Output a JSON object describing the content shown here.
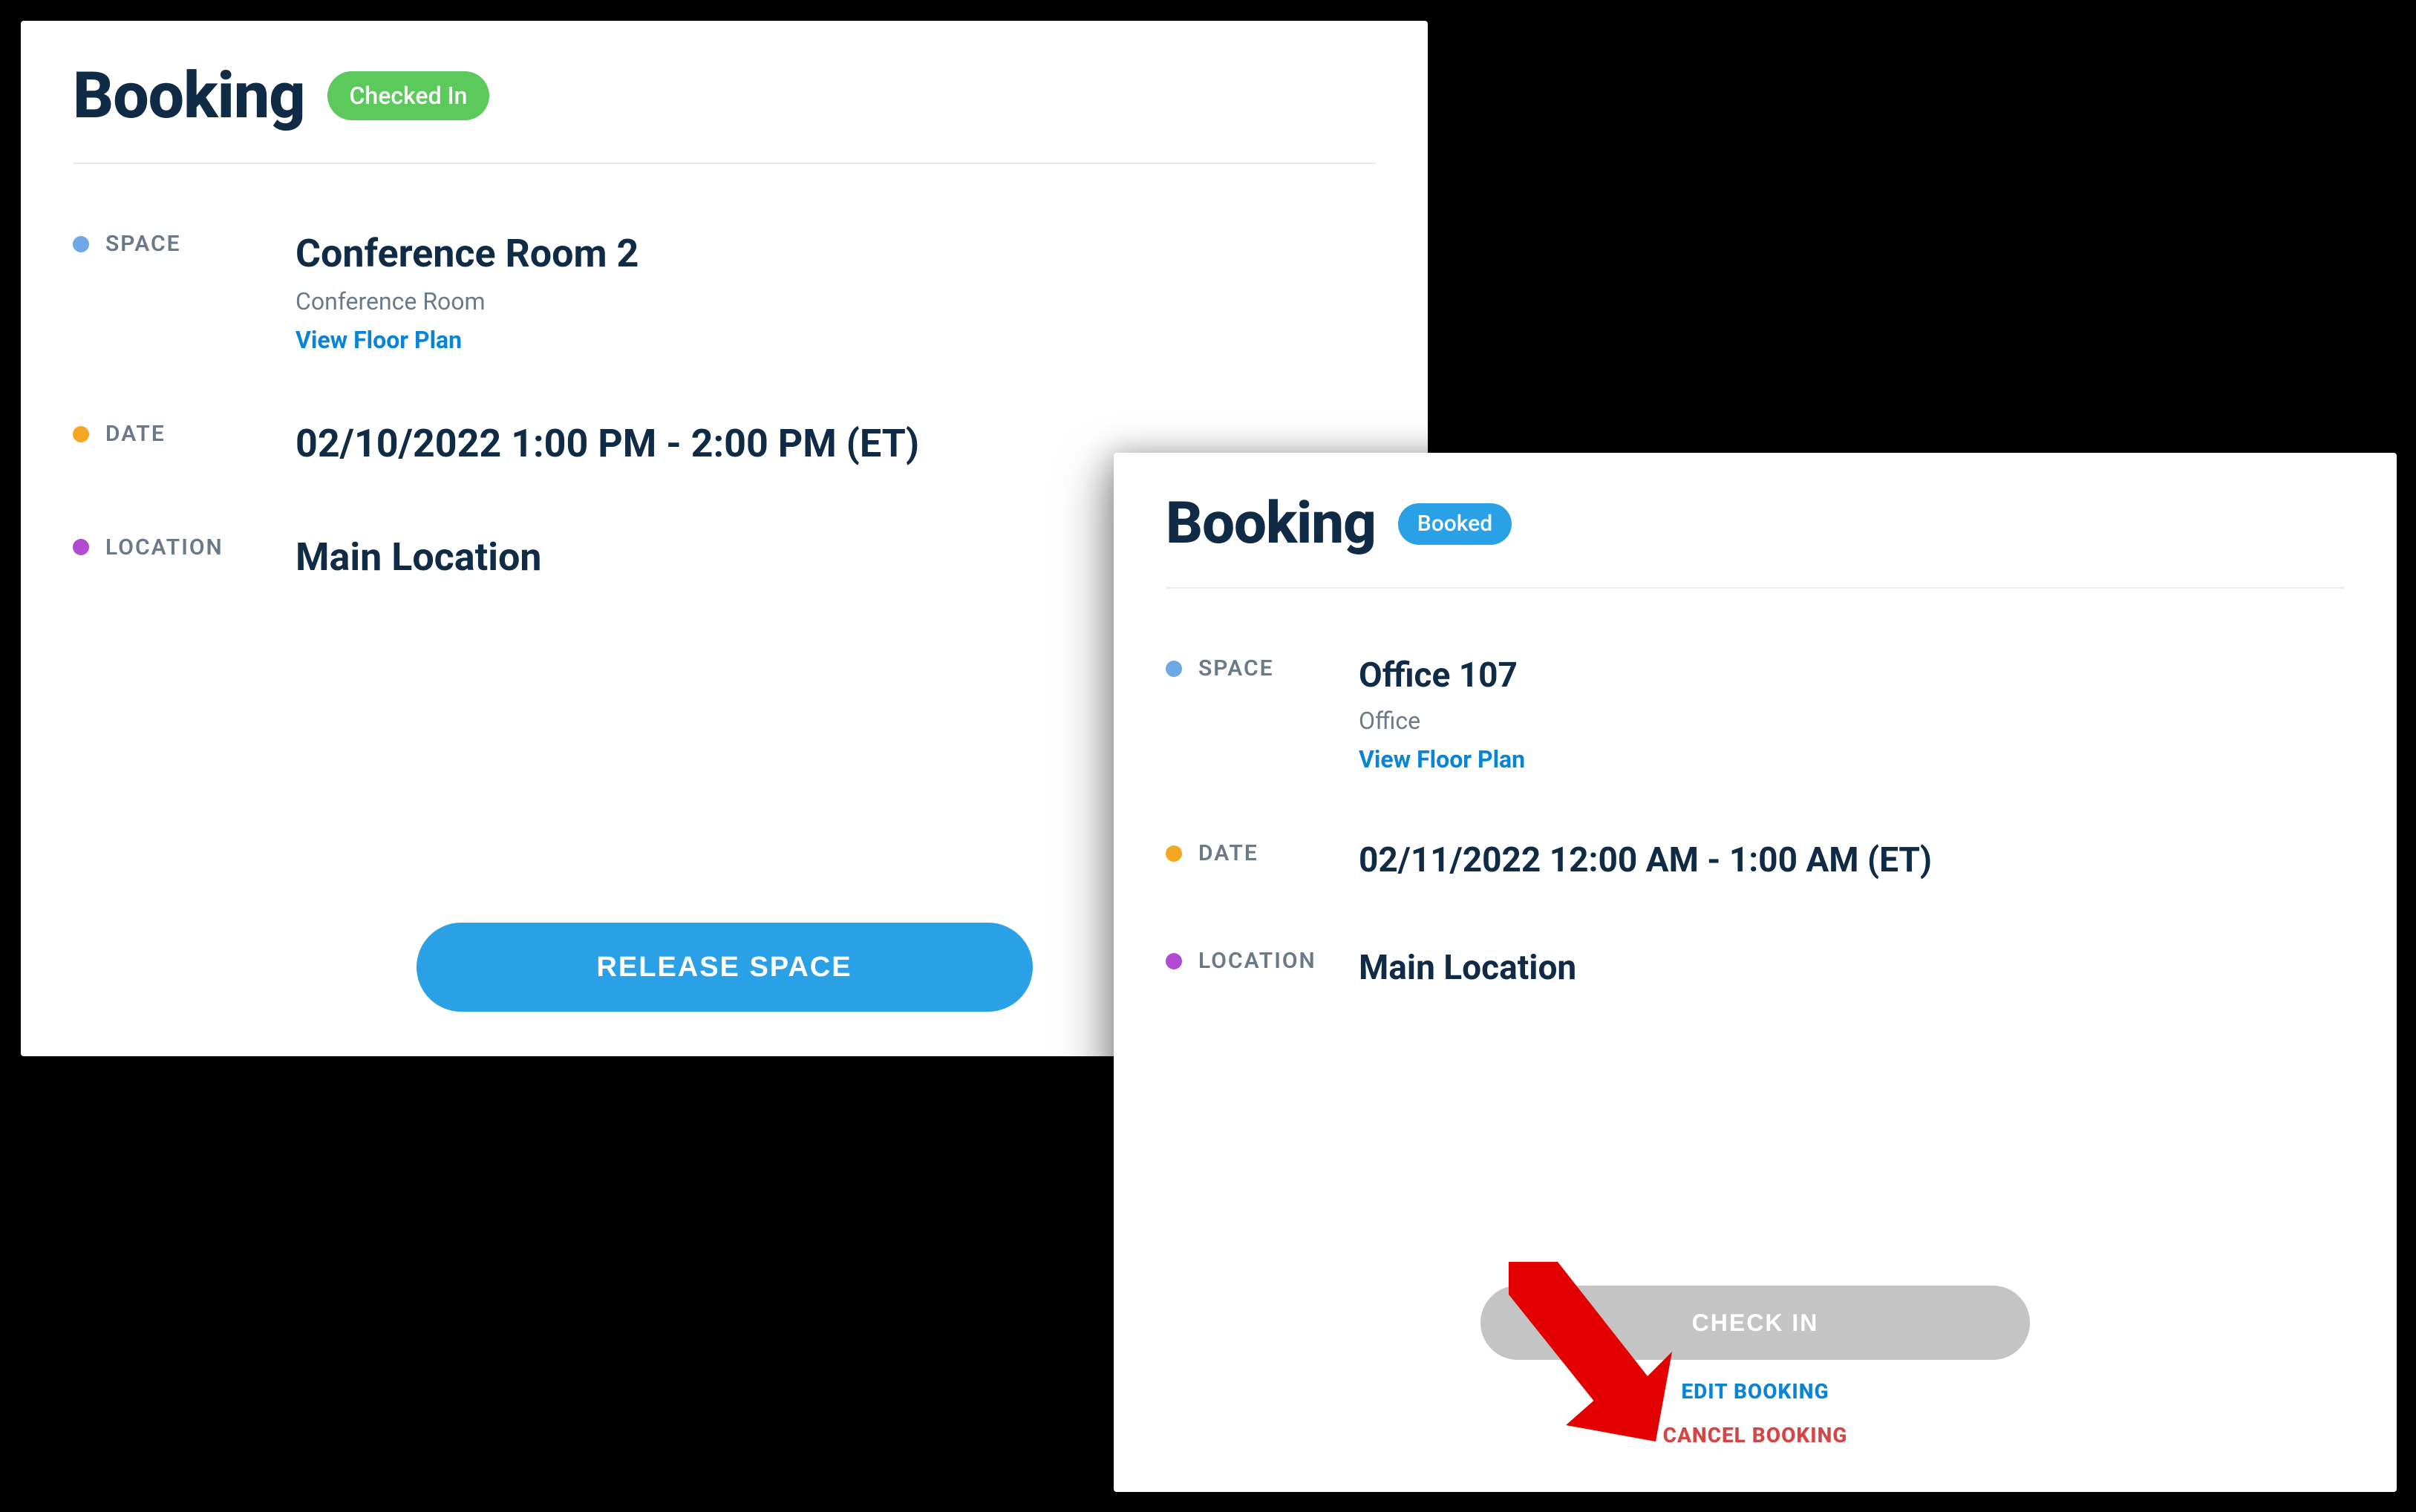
{
  "card_a": {
    "title": "Booking",
    "status": "Checked In",
    "labels": {
      "space": "SPACE",
      "date": "DATE",
      "location": "LOCATION"
    },
    "space": {
      "name": "Conference Room 2",
      "type": "Conference Room",
      "floorplan_link": "View Floor Plan"
    },
    "date": "02/10/2022 1:00 PM - 2:00 PM (ET)",
    "location": "Main Location",
    "actions": {
      "release": "RELEASE SPACE"
    }
  },
  "card_b": {
    "title": "Booking",
    "status": "Booked",
    "labels": {
      "space": "SPACE",
      "date": "DATE",
      "location": "LOCATION"
    },
    "space": {
      "name": "Office 107",
      "type": "Office",
      "floorplan_link": "View Floor Plan"
    },
    "date": "02/11/2022 12:00 AM - 1:00 AM (ET)",
    "location": "Main Location",
    "actions": {
      "checkin": "CHECK IN",
      "edit": "EDIT BOOKING",
      "cancel": "CANCEL BOOKING"
    }
  },
  "colors": {
    "status_checked_in": "#5cc95c",
    "status_booked": "#2aa0e6",
    "dot_space": "#6ea8e8",
    "dot_date": "#f5a623",
    "dot_location": "#b24bd1",
    "link": "#0a84d6",
    "danger": "#d64545",
    "annotation_arrow": "#e30000"
  }
}
